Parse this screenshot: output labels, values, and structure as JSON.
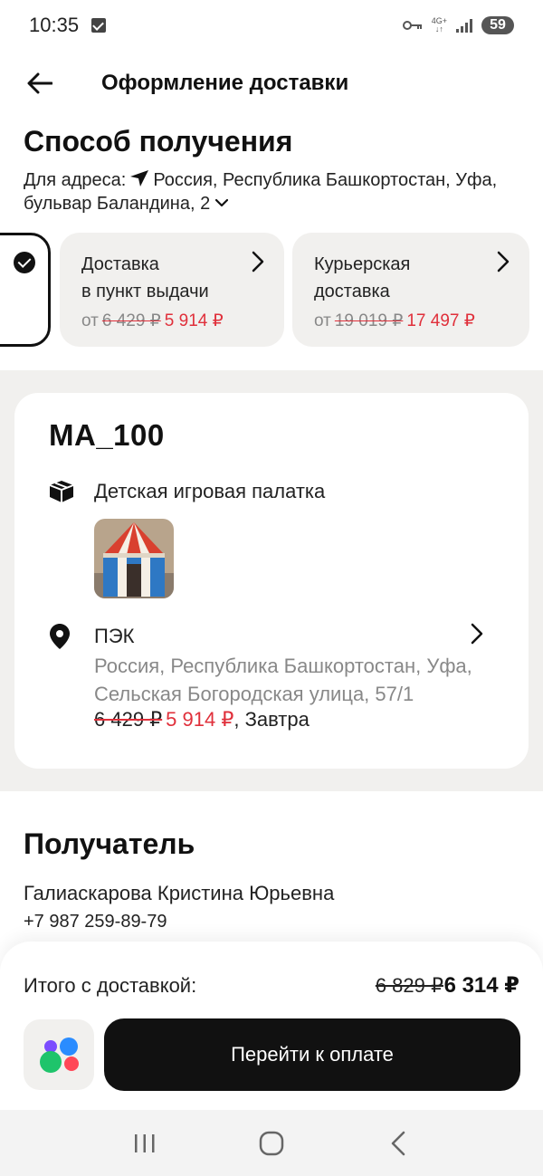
{
  "status_bar": {
    "time": "10:35",
    "network": "4G+",
    "battery": "59",
    "icons": [
      "checkbox-notification-icon",
      "key-icon",
      "signal-icon",
      "battery-icon"
    ]
  },
  "header": {
    "title": "Оформление доставки",
    "back_icon": "arrow-left-icon"
  },
  "delivery_method": {
    "title": "Способ получения",
    "address_label": "Для адреса:",
    "address": "Россия, Республика Башкортостан, Уфа, бульвар Баландина, 2",
    "options": [
      {
        "title": "Доставка\nв пункт выдачи",
        "prefix": "от",
        "old_price": "6 429 ₽",
        "new_price": "5 914 ₽"
      },
      {
        "title": "Курьерская\nдоставка",
        "prefix": "от",
        "old_price": "19 019 ₽",
        "new_price": "17 497 ₽"
      }
    ]
  },
  "order": {
    "id": "MA_100",
    "product_name": "Детская игровая палатка",
    "pickup": {
      "title": "ПЭК",
      "address": "Россия, Республика Башкортостан, Уфа, Сельская Богородская улица, 57/1",
      "old_price": "6 429 ₽",
      "new_price": "5 914 ₽",
      "when": ", Завтра"
    }
  },
  "recipient": {
    "title": "Получатель",
    "name": "Галиаскарова Кристина Юрьевна",
    "phone": "+7 987 259-89-79"
  },
  "checkout": {
    "total_label": "Итого с доставкой:",
    "old_total": "6 829 ₽",
    "new_total": "6 314 ₽",
    "pay_label": "Перейти к оплате"
  },
  "colors": {
    "accent_red": "#e0303b",
    "card_bg": "#f1f0ee",
    "primary_button": "#111111"
  }
}
